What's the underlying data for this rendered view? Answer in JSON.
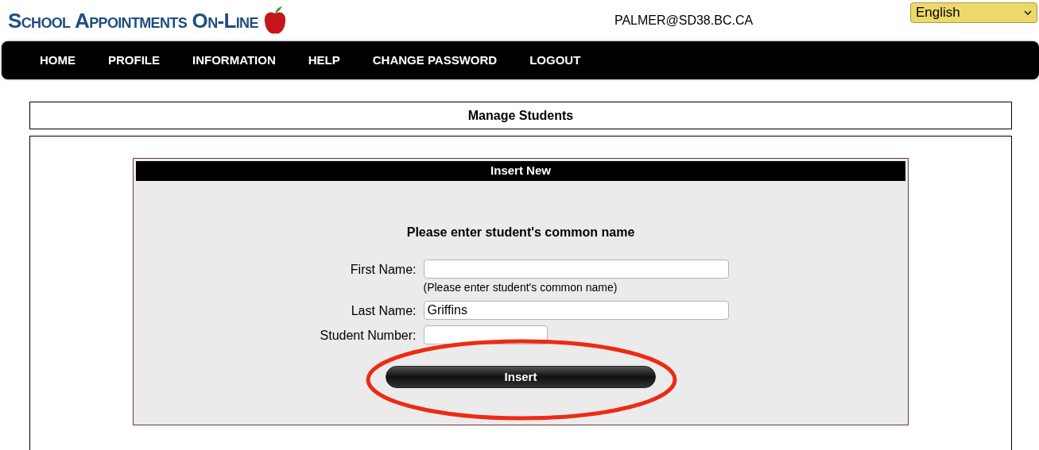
{
  "header": {
    "logo": "School Appointments On-Line",
    "user_email": "PALMER@SD38.BC.CA",
    "language": "English"
  },
  "nav": [
    "HOME",
    "PROFILE",
    "INFORMATION",
    "HELP",
    "CHANGE PASSWORD",
    "LOGOUT"
  ],
  "page_title": "Manage Students",
  "panel": {
    "title": "Insert New",
    "instruction": "Please enter student's common name",
    "fields": [
      {
        "kind": "wide",
        "label": "First Name:",
        "hint": "(Please enter student's common name)"
      },
      {
        "kind": "wide",
        "label": "Last Name:",
        "value": "Griffins"
      },
      {
        "kind": "narrow",
        "label": "Student Number:"
      }
    ],
    "button": "Insert"
  }
}
